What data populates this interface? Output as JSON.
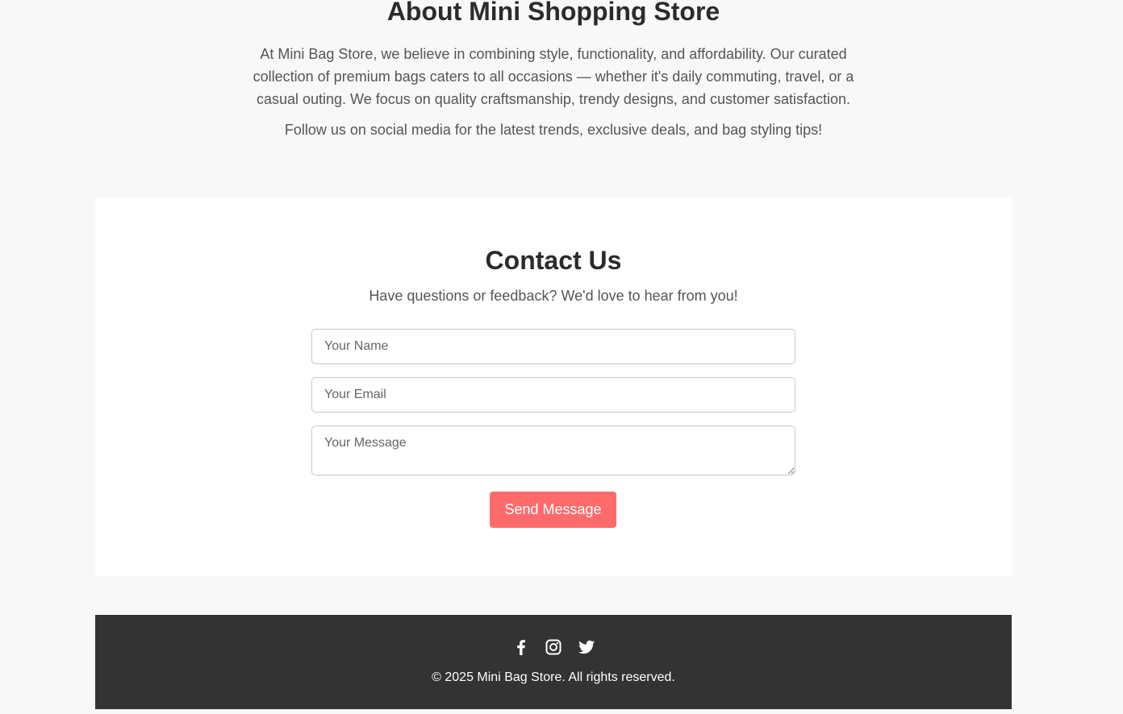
{
  "about": {
    "title": "About Mini Shopping Store",
    "paragraph1": "At Mini Bag Store, we believe in combining style, functionality, and affordability. Our curated collection of premium bags caters to all occasions — whether it's daily commuting, travel, or a casual outing. We focus on quality craftsmanship, trendy designs, and customer satisfaction.",
    "paragraph2": "Follow us on social media for the latest trends, exclusive deals, and bag styling tips!"
  },
  "contact": {
    "title": "Contact Us",
    "subtitle": "Have questions or feedback? We'd love to hear from you!",
    "name_placeholder": "Your Name",
    "email_placeholder": "Your Email",
    "message_placeholder": "Your Message",
    "send_label": "Send Message"
  },
  "footer": {
    "social_icons": [
      "facebook-icon",
      "instagram-icon",
      "twitter-icon"
    ],
    "copyright": "© 2025 Mini Bag Store. All rights reserved."
  },
  "colors": {
    "accent": "#ff6b6b",
    "footer_bg": "#333333",
    "page_bg": "#f8f8f8"
  }
}
